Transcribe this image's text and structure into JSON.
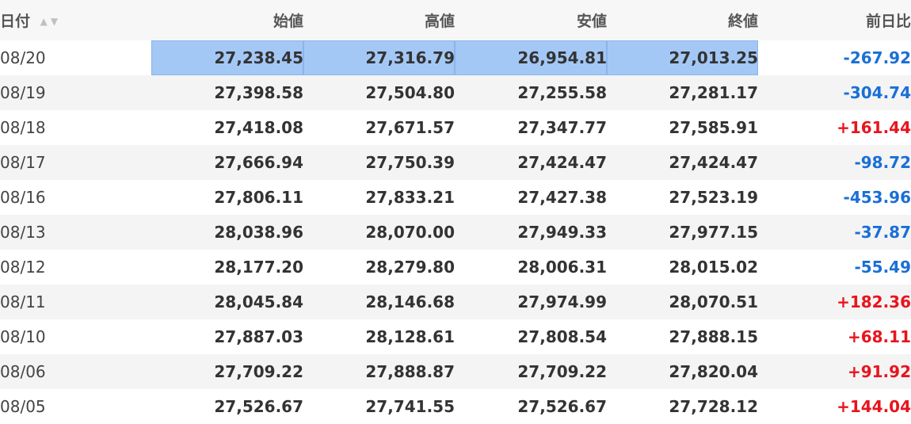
{
  "headers": {
    "date": "日付",
    "open": "始値",
    "high": "高値",
    "low": "安値",
    "close": "終値",
    "change": "前日比"
  },
  "rows": [
    {
      "date": "08/20",
      "open": "27,238.45",
      "high": "27,316.79",
      "low": "26,954.81",
      "close": "27,013.25",
      "change": "-267.92"
    },
    {
      "date": "08/19",
      "open": "27,398.58",
      "high": "27,504.80",
      "low": "27,255.58",
      "close": "27,281.17",
      "change": "-304.74"
    },
    {
      "date": "08/18",
      "open": "27,418.08",
      "high": "27,671.57",
      "low": "27,347.77",
      "close": "27,585.91",
      "change": "+161.44"
    },
    {
      "date": "08/17",
      "open": "27,666.94",
      "high": "27,750.39",
      "low": "27,424.47",
      "close": "27,424.47",
      "change": "-98.72"
    },
    {
      "date": "08/16",
      "open": "27,806.11",
      "high": "27,833.21",
      "low": "27,427.38",
      "close": "27,523.19",
      "change": "-453.96"
    },
    {
      "date": "08/13",
      "open": "28,038.96",
      "high": "28,070.00",
      "low": "27,949.33",
      "close": "27,977.15",
      "change": "-37.87"
    },
    {
      "date": "08/12",
      "open": "28,177.20",
      "high": "28,279.80",
      "low": "28,006.31",
      "close": "28,015.02",
      "change": "-55.49"
    },
    {
      "date": "08/11",
      "open": "28,045.84",
      "high": "28,146.68",
      "low": "27,974.99",
      "close": "28,070.51",
      "change": "+182.36"
    },
    {
      "date": "08/10",
      "open": "27,887.03",
      "high": "28,128.61",
      "low": "27,808.54",
      "close": "27,888.15",
      "change": "+68.11"
    },
    {
      "date": "08/06",
      "open": "27,709.22",
      "high": "27,888.87",
      "low": "27,709.22",
      "close": "27,820.04",
      "change": "+91.92"
    },
    {
      "date": "08/05",
      "open": "27,526.67",
      "high": "27,741.55",
      "low": "27,526.67",
      "close": "27,728.12",
      "change": "+144.04"
    }
  ],
  "colors": {
    "down": "#1a6fd6",
    "up": "#e8141d",
    "selection": "#a4c8f5"
  },
  "icons": {
    "sort_up": "sort-ascending-icon",
    "sort_down": "sort-descending-icon"
  }
}
